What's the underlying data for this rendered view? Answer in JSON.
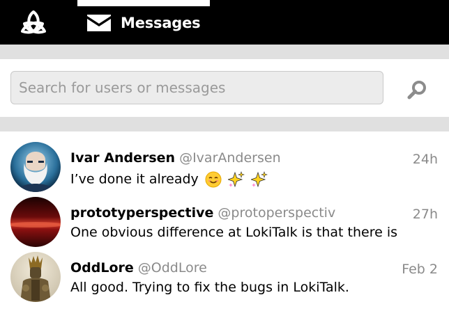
{
  "app": {
    "logo_icon": "loki-triquetra-logo",
    "active_tab": {
      "icon": "mail-icon",
      "label": "Messages"
    }
  },
  "search": {
    "placeholder": "Search for users or messages",
    "value": "",
    "icon": "search-icon"
  },
  "conversations": [
    {
      "name": "Ivar Andersen",
      "handle": "@IvarAndersen",
      "time": "24h",
      "preview": "I’ve done it already",
      "preview_emojis": [
        "smiling-face-emoji",
        "sparkles-emoji",
        "sparkles-emoji"
      ]
    },
    {
      "name": "prototyperspective",
      "handle": "@protoperspectiv",
      "time": "27h",
      "preview": "One obvious difference at LokiTalk is that there is"
    },
    {
      "name": "OddLore",
      "handle": "@OddLore",
      "time": "Feb 2",
      "preview": "All good. Trying to fix the bugs in LokiTalk."
    }
  ],
  "colors": {
    "topbar": "#000000",
    "separator": "#e0e0e0",
    "muted_text": "#8a8a8a",
    "search_field": "#ececec"
  }
}
